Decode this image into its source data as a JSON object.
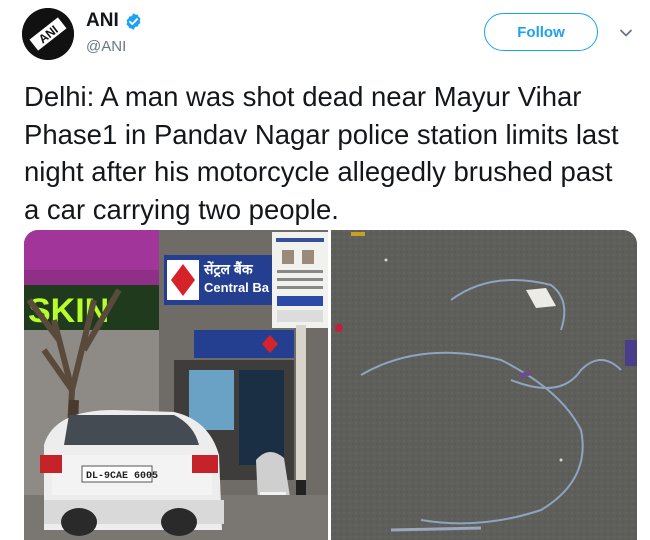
{
  "account": {
    "name": "ANI",
    "handle": "@ANI",
    "verified": true,
    "avatar_icon": "ani-logo",
    "avatar_text": "ANI"
  },
  "follow_button": {
    "label": "Follow"
  },
  "tweet": {
    "text": "Delhi: A man was shot dead near Mayur Vihar Phase1 in Pandav Nagar police station limits last night after his motorcycle allegedly brushed past a car carrying two people."
  },
  "media": {
    "left_photo": {
      "signboard_hindi": "सेंट्रल बैंक",
      "signboard": "Central Ba",
      "store_sign": "SKIN",
      "plate": "DL-9CAE 6005"
    },
    "right_photo": {}
  },
  "colors": {
    "accent": "#1da1f2",
    "verified": "#1da1f2",
    "text": "#14171a",
    "secondary_text": "#657786"
  }
}
